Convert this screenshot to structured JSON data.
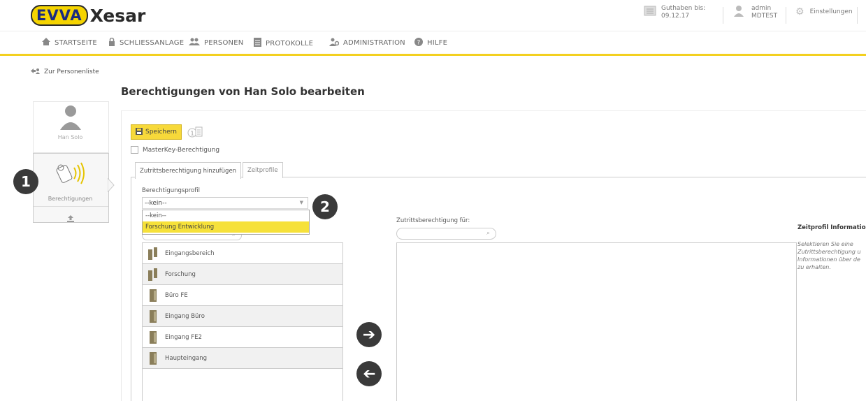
{
  "header": {
    "logo_badge": "EVVA",
    "logo_word": "Xesar",
    "credit_label": "Guthaben bis:",
    "credit_value": "09.12.17",
    "user_name": "admin",
    "user_site": "MDTEST",
    "settings_label": "Einstellungen"
  },
  "nav": {
    "items": [
      {
        "label": "STARTSEITE",
        "icon": "home-icon"
      },
      {
        "label": "SCHLIESSANLAGE",
        "icon": "lock-icon"
      },
      {
        "label": "PERSONEN",
        "icon": "persons-icon"
      },
      {
        "label": "PROTOKOLLE",
        "icon": "document-icon"
      },
      {
        "label": "ADMINISTRATION",
        "icon": "admin-icon"
      },
      {
        "label": "HILFE",
        "icon": "help-icon"
      }
    ]
  },
  "back_link": "Zur Personenliste",
  "page_title": "Berechtigungen von Han Solo bearbeiten",
  "person": {
    "name": "Han Solo",
    "permissions_label": "Berechtigungen"
  },
  "callouts": [
    "1",
    "2"
  ],
  "toolbar": {
    "save_label": "Speichern",
    "masterkey_label": "MasterKey-Berechtigung"
  },
  "tabs": [
    {
      "label": "Zutrittsberechtigung hinzufügen",
      "active": true
    },
    {
      "label": "Zeitprofile",
      "active": false
    }
  ],
  "profile": {
    "label": "Berechtigungsprofil",
    "selected": "--kein--",
    "options": [
      "--kein--",
      "Forschung Entwicklung"
    ],
    "highlighted_option": "Forschung Entwicklung"
  },
  "doors": [
    {
      "name": "Eingangsbereich",
      "icon": "door-group-icon"
    },
    {
      "name": "Forschung",
      "icon": "door-group-icon"
    },
    {
      "name": "Büro FE",
      "icon": "door-icon"
    },
    {
      "name": "Eingang Büro",
      "icon": "door-icon"
    },
    {
      "name": "Eingang FE2",
      "icon": "door-icon"
    },
    {
      "name": "Haupteingang",
      "icon": "door-icon"
    }
  ],
  "target": {
    "label": "Zutrittsberechtigung für:"
  },
  "zeitprofil": {
    "title": "Zeitprofil Information",
    "text": "Selektieren Sie eine Zutrittsberechtigung u Informationen über de zu erhalten."
  },
  "colors": {
    "accent_yellow": "#f3d01f",
    "dark_button": "#3a3a3a"
  }
}
